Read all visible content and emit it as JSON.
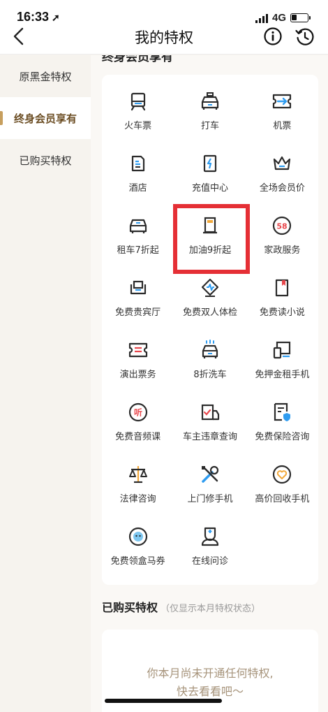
{
  "status": {
    "time": "16:33",
    "network": "4G"
  },
  "nav": {
    "title": "我的特权",
    "back_icon": "chevron-left-icon",
    "info_icon": "info-icon",
    "history_icon": "history-icon"
  },
  "sidebar": {
    "items": [
      {
        "label": "原黑金特权",
        "active": false
      },
      {
        "label": "终身会员享有",
        "active": true
      },
      {
        "label": "已购买特权",
        "active": false
      }
    ]
  },
  "main": {
    "section_title": "终身会员享有",
    "privileges": [
      {
        "label": "火车票",
        "icon": "train-icon"
      },
      {
        "label": "打车",
        "icon": "taxi-icon"
      },
      {
        "label": "机票",
        "icon": "flight-ticket-icon"
      },
      {
        "label": "酒店",
        "icon": "hotel-icon"
      },
      {
        "label": "充值中心",
        "icon": "recharge-icon"
      },
      {
        "label": "全场会员价",
        "icon": "crown-icon"
      },
      {
        "label": "租车7折起",
        "icon": "car-rental-icon"
      },
      {
        "label": "加油9折起",
        "icon": "fuel-icon"
      },
      {
        "label": "家政服务",
        "icon": "housekeeping-58-icon"
      },
      {
        "label": "免费贵宾厅",
        "icon": "vip-lounge-icon"
      },
      {
        "label": "免费双人体检",
        "icon": "health-check-icon"
      },
      {
        "label": "免费读小说",
        "icon": "book-icon"
      },
      {
        "label": "演出票务",
        "icon": "show-ticket-icon"
      },
      {
        "label": "8折洗车",
        "icon": "car-wash-icon"
      },
      {
        "label": "免押金租手机",
        "icon": "phone-rental-icon"
      },
      {
        "label": "免费音频课",
        "icon": "audio-course-icon"
      },
      {
        "label": "车主违章查询",
        "icon": "violation-query-icon"
      },
      {
        "label": "免费保险咨询",
        "icon": "insurance-icon"
      },
      {
        "label": "法律咨询",
        "icon": "scales-icon"
      },
      {
        "label": "上门修手机",
        "icon": "repair-tools-icon"
      },
      {
        "label": "高价回收手机",
        "icon": "recycle-heart-icon"
      },
      {
        "label": "免费领盒马券",
        "icon": "hema-coupon-icon"
      },
      {
        "label": "在线问诊",
        "icon": "doctor-icon"
      }
    ],
    "listen_badge": "听",
    "badge_58": "58"
  },
  "bought": {
    "title": "已购买特权",
    "note": "（仅显示本月特权状态）",
    "empty_line1": "你本月尚未开通任何特权,",
    "empty_line2": "快去看看吧～"
  },
  "colors": {
    "accent": "#c79f5e",
    "icon_dark": "#2b2b2b",
    "icon_blue": "#2f9cf0",
    "highlight": "#e52f35",
    "badge_red": "#e8474c"
  }
}
